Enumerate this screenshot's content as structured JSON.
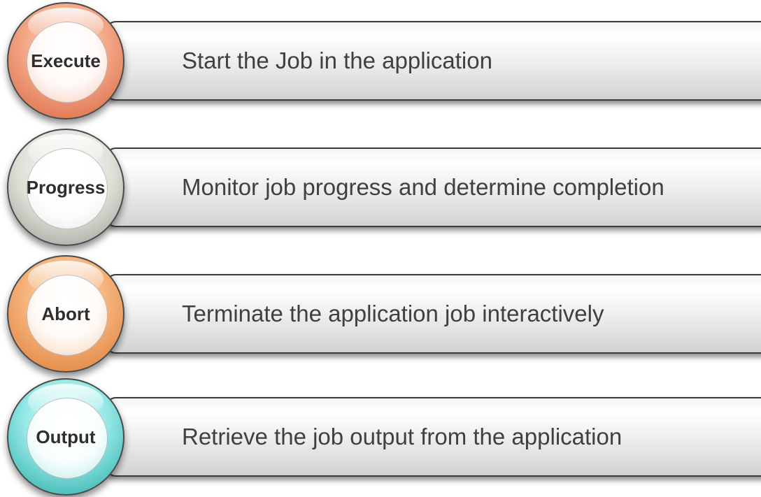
{
  "steps": [
    {
      "label": "Execute",
      "description": "Start the Job in the application",
      "circle_color": "#e57a52"
    },
    {
      "label": "Progress",
      "description": "Monitor job progress and determine completion",
      "circle_color": "#c8c9c1"
    },
    {
      "label": "Abort",
      "description": "Terminate the application job interactively",
      "circle_color": "#ec9a55"
    },
    {
      "label": "Output",
      "description": "Retrieve the job output from the application",
      "circle_color": "#5dd0cc"
    }
  ]
}
